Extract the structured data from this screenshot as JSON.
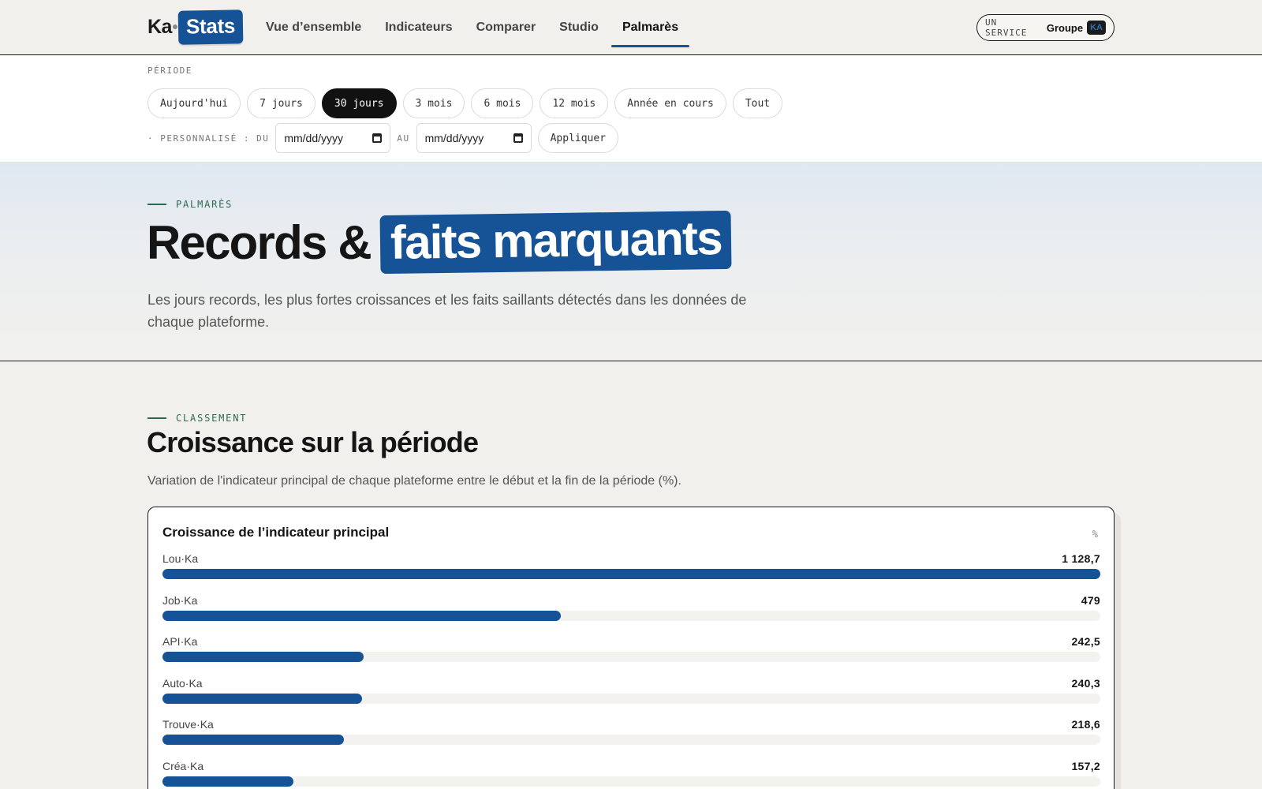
{
  "header": {
    "logo": {
      "ka": "Ka",
      "stats": "Stats"
    },
    "nav": [
      {
        "label": "Vue d’ensemble",
        "active": false
      },
      {
        "label": "Indicateurs",
        "active": false
      },
      {
        "label": "Comparer",
        "active": false
      },
      {
        "label": "Studio",
        "active": false
      },
      {
        "label": "Palmarès",
        "active": true
      }
    ],
    "service": {
      "label": "UN SERVICE",
      "groupe": "Groupe",
      "ka": "KA"
    }
  },
  "period": {
    "label": "PÉRIODE",
    "chips": [
      {
        "label": "Aujourd'hui",
        "active": false
      },
      {
        "label": "7 jours",
        "active": false
      },
      {
        "label": "30 jours",
        "active": true
      },
      {
        "label": "3 mois",
        "active": false
      },
      {
        "label": "6 mois",
        "active": false
      },
      {
        "label": "12 mois",
        "active": false
      },
      {
        "label": "Année en cours",
        "active": false
      },
      {
        "label": "Tout",
        "active": false
      }
    ],
    "custom_label": "· PERSONNALISÉ : DU",
    "from_placeholder": "mm/dd/yyyy",
    "to_label": "AU",
    "to_placeholder": "mm/dd/yyyy",
    "apply_label": "Appliquer"
  },
  "hero": {
    "eyebrow": "PALMARÈS",
    "title_plain": "Records &",
    "title_highlight": "faits marquants",
    "subtitle": "Les jours records, les plus fortes croissances et les faits saillants détectés dans les données de chaque plateforme."
  },
  "ranking": {
    "eyebrow": "CLASSEMENT",
    "title": "Croissance sur la période",
    "subtitle": "Variation de l'indicateur principal de chaque plateforme entre le début et la fin de la période (%).",
    "card_title": "Croissance de l’indicateur principal",
    "unit": "%"
  },
  "colors": {
    "accent": "#165296",
    "ink": "#1b1b1b",
    "eyebrow": "#2d6b4f"
  },
  "chart_data": {
    "type": "bar",
    "orientation": "horizontal",
    "title": "Croissance de l’indicateur principal",
    "unit": "%",
    "categories": [
      "Lou·Ka",
      "Job·Ka",
      "API·Ka",
      "Auto·Ka",
      "Trouve·Ka",
      "Créa·Ka"
    ],
    "values": [
      1128.7,
      479,
      242.5,
      240.3,
      218.6,
      157.2
    ],
    "value_labels": [
      "1 128,7",
      "479",
      "242,5",
      "240,3",
      "218,6",
      "157,2"
    ],
    "xlim": [
      0,
      1128.7
    ]
  }
}
